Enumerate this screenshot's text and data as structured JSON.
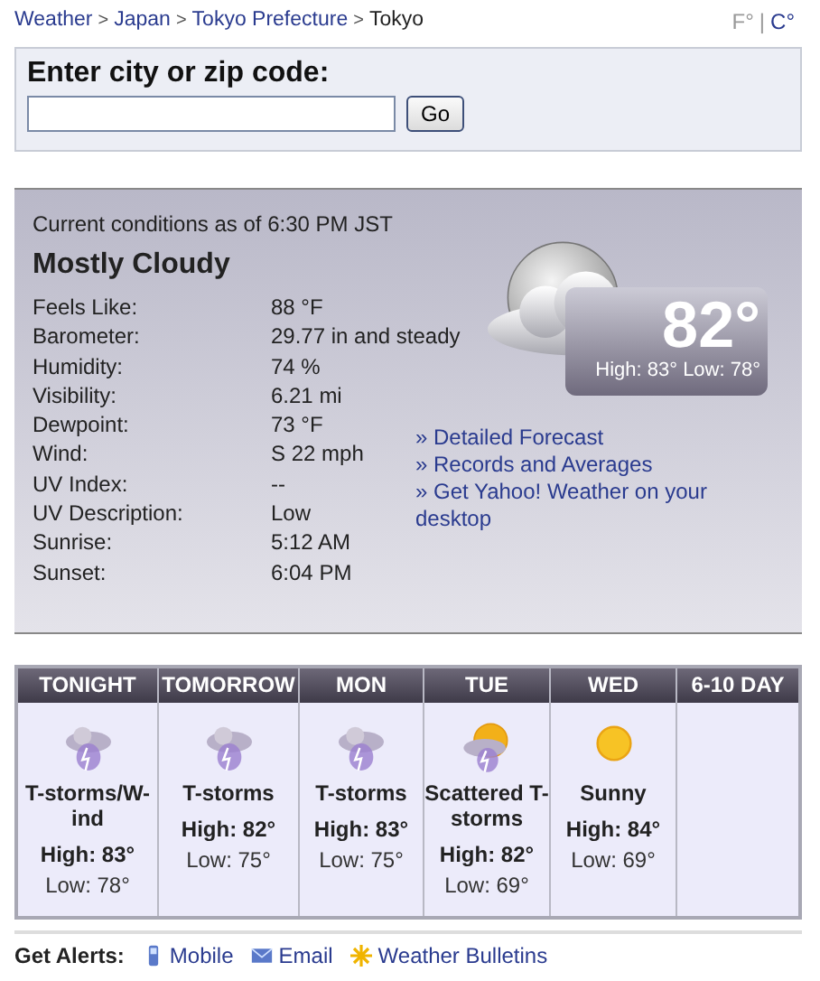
{
  "breadcrumb": [
    {
      "label": "Weather",
      "current": false
    },
    {
      "label": "Japan",
      "current": false
    },
    {
      "label": "Tokyo Prefecture",
      "current": false
    },
    {
      "label": "Tokyo",
      "current": true
    }
  ],
  "separator": ">",
  "units": [
    {
      "label": "F°",
      "selected": true
    },
    {
      "label": "C°",
      "selected": false
    }
  ],
  "units_divider": "|",
  "search": {
    "title": "Enter city or zip code:",
    "button": "Go"
  },
  "current": {
    "as_of": "Current conditions as of 6:30 PM JST",
    "condition": "Mostly Cloudy",
    "temperature": "82°",
    "high_low": "High: 83° Low: 78°",
    "details": [
      {
        "label": "Feels Like:",
        "value": "88 °F"
      },
      {
        "label": "Barometer:",
        "value": "29.77 in and steady"
      },
      {
        "label": "Humidity:",
        "value": "74 %"
      },
      {
        "label": "Visibility:",
        "value": "6.21 mi"
      },
      {
        "label": "Dewpoint:",
        "value": "73 °F"
      },
      {
        "label": "Wind:",
        "value": "S 22 mph"
      },
      {
        "label": "UV Index:",
        "value": "--"
      },
      {
        "label": "UV Description:",
        "value": "Low"
      },
      {
        "label": "Sunrise:",
        "value": "5:12 AM"
      },
      {
        "label": "Sunset:",
        "value": "6:04 PM"
      }
    ],
    "links": [
      "» Detailed Forecast",
      "» Records and Averages",
      "» Get Yahoo! Weather on your desktop"
    ]
  },
  "forecast": [
    {
      "day": "TONIGHT",
      "kind": "storm",
      "condition": "T-storms/W-ind",
      "high": "High: 83°",
      "low": "Low: 78°"
    },
    {
      "day": "TOMORROW",
      "kind": "storm",
      "condition": "T-storms",
      "high": "High: 82°",
      "low": "Low: 75°"
    },
    {
      "day": "MON",
      "kind": "storm",
      "condition": "T-storms",
      "high": "High: 83°",
      "low": "Low: 75°"
    },
    {
      "day": "TUE",
      "kind": "scattered",
      "condition": "Scattered T-storms",
      "high": "High: 82°",
      "low": "Low: 69°"
    },
    {
      "day": "WED",
      "kind": "sunny",
      "condition": "Sunny",
      "high": "High: 84°",
      "low": "Low: 69°"
    },
    {
      "day": "6-10 DAY",
      "kind": "empty"
    }
  ],
  "alerts": {
    "label": "Get Alerts:",
    "links": [
      {
        "kind": "mobile",
        "label": "Mobile"
      },
      {
        "kind": "email",
        "label": "Email"
      },
      {
        "kind": "bulletins",
        "label": "Weather Bulletins"
      }
    ]
  }
}
